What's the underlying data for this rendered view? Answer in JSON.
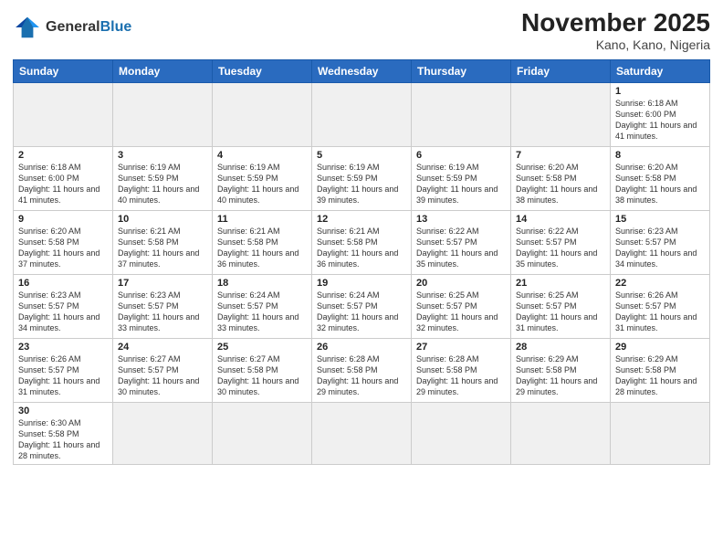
{
  "header": {
    "logo_general": "General",
    "logo_blue": "Blue",
    "title": "November 2025",
    "subtitle": "Kano, Kano, Nigeria"
  },
  "days_of_week": [
    "Sunday",
    "Monday",
    "Tuesday",
    "Wednesday",
    "Thursday",
    "Friday",
    "Saturday"
  ],
  "weeks": [
    [
      {
        "day": "",
        "info": ""
      },
      {
        "day": "",
        "info": ""
      },
      {
        "day": "",
        "info": ""
      },
      {
        "day": "",
        "info": ""
      },
      {
        "day": "",
        "info": ""
      },
      {
        "day": "",
        "info": ""
      },
      {
        "day": "1",
        "info": "Sunrise: 6:18 AM\nSunset: 6:00 PM\nDaylight: 11 hours\nand 41 minutes."
      }
    ],
    [
      {
        "day": "2",
        "info": "Sunrise: 6:18 AM\nSunset: 6:00 PM\nDaylight: 11 hours\nand 41 minutes."
      },
      {
        "day": "3",
        "info": "Sunrise: 6:19 AM\nSunset: 5:59 PM\nDaylight: 11 hours\nand 40 minutes."
      },
      {
        "day": "4",
        "info": "Sunrise: 6:19 AM\nSunset: 5:59 PM\nDaylight: 11 hours\nand 40 minutes."
      },
      {
        "day": "5",
        "info": "Sunrise: 6:19 AM\nSunset: 5:59 PM\nDaylight: 11 hours\nand 39 minutes."
      },
      {
        "day": "6",
        "info": "Sunrise: 6:19 AM\nSunset: 5:59 PM\nDaylight: 11 hours\nand 39 minutes."
      },
      {
        "day": "7",
        "info": "Sunrise: 6:20 AM\nSunset: 5:58 PM\nDaylight: 11 hours\nand 38 minutes."
      },
      {
        "day": "8",
        "info": "Sunrise: 6:20 AM\nSunset: 5:58 PM\nDaylight: 11 hours\nand 38 minutes."
      }
    ],
    [
      {
        "day": "9",
        "info": "Sunrise: 6:20 AM\nSunset: 5:58 PM\nDaylight: 11 hours\nand 37 minutes."
      },
      {
        "day": "10",
        "info": "Sunrise: 6:21 AM\nSunset: 5:58 PM\nDaylight: 11 hours\nand 37 minutes."
      },
      {
        "day": "11",
        "info": "Sunrise: 6:21 AM\nSunset: 5:58 PM\nDaylight: 11 hours\nand 36 minutes."
      },
      {
        "day": "12",
        "info": "Sunrise: 6:21 AM\nSunset: 5:58 PM\nDaylight: 11 hours\nand 36 minutes."
      },
      {
        "day": "13",
        "info": "Sunrise: 6:22 AM\nSunset: 5:57 PM\nDaylight: 11 hours\nand 35 minutes."
      },
      {
        "day": "14",
        "info": "Sunrise: 6:22 AM\nSunset: 5:57 PM\nDaylight: 11 hours\nand 35 minutes."
      },
      {
        "day": "15",
        "info": "Sunrise: 6:23 AM\nSunset: 5:57 PM\nDaylight: 11 hours\nand 34 minutes."
      }
    ],
    [
      {
        "day": "16",
        "info": "Sunrise: 6:23 AM\nSunset: 5:57 PM\nDaylight: 11 hours\nand 34 minutes."
      },
      {
        "day": "17",
        "info": "Sunrise: 6:23 AM\nSunset: 5:57 PM\nDaylight: 11 hours\nand 33 minutes."
      },
      {
        "day": "18",
        "info": "Sunrise: 6:24 AM\nSunset: 5:57 PM\nDaylight: 11 hours\nand 33 minutes."
      },
      {
        "day": "19",
        "info": "Sunrise: 6:24 AM\nSunset: 5:57 PM\nDaylight: 11 hours\nand 32 minutes."
      },
      {
        "day": "20",
        "info": "Sunrise: 6:25 AM\nSunset: 5:57 PM\nDaylight: 11 hours\nand 32 minutes."
      },
      {
        "day": "21",
        "info": "Sunrise: 6:25 AM\nSunset: 5:57 PM\nDaylight: 11 hours\nand 31 minutes."
      },
      {
        "day": "22",
        "info": "Sunrise: 6:26 AM\nSunset: 5:57 PM\nDaylight: 11 hours\nand 31 minutes."
      }
    ],
    [
      {
        "day": "23",
        "info": "Sunrise: 6:26 AM\nSunset: 5:57 PM\nDaylight: 11 hours\nand 31 minutes."
      },
      {
        "day": "24",
        "info": "Sunrise: 6:27 AM\nSunset: 5:57 PM\nDaylight: 11 hours\nand 30 minutes."
      },
      {
        "day": "25",
        "info": "Sunrise: 6:27 AM\nSunset: 5:58 PM\nDaylight: 11 hours\nand 30 minutes."
      },
      {
        "day": "26",
        "info": "Sunrise: 6:28 AM\nSunset: 5:58 PM\nDaylight: 11 hours\nand 29 minutes."
      },
      {
        "day": "27",
        "info": "Sunrise: 6:28 AM\nSunset: 5:58 PM\nDaylight: 11 hours\nand 29 minutes."
      },
      {
        "day": "28",
        "info": "Sunrise: 6:29 AM\nSunset: 5:58 PM\nDaylight: 11 hours\nand 29 minutes."
      },
      {
        "day": "29",
        "info": "Sunrise: 6:29 AM\nSunset: 5:58 PM\nDaylight: 11 hours\nand 28 minutes."
      }
    ],
    [
      {
        "day": "30",
        "info": "Sunrise: 6:30 AM\nSunset: 5:58 PM\nDaylight: 11 hours\nand 28 minutes."
      },
      {
        "day": "",
        "info": ""
      },
      {
        "day": "",
        "info": ""
      },
      {
        "day": "",
        "info": ""
      },
      {
        "day": "",
        "info": ""
      },
      {
        "day": "",
        "info": ""
      },
      {
        "day": "",
        "info": ""
      }
    ]
  ]
}
